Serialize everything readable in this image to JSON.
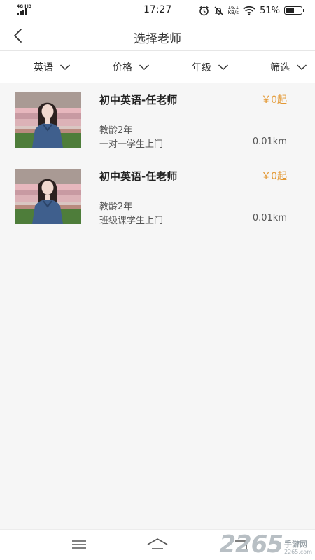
{
  "status_bar": {
    "network": "4G HD",
    "time": "17:27",
    "speed_value": "16.1",
    "speed_unit": "KB/s",
    "battery_level": "51%"
  },
  "header": {
    "title": "选择老师"
  },
  "filters": [
    {
      "label": "英语"
    },
    {
      "label": "价格"
    },
    {
      "label": "年级"
    },
    {
      "label": "筛选"
    }
  ],
  "teachers": [
    {
      "title": "初中英语-任老师",
      "price": "￥0起",
      "experience": "教龄2年",
      "mode": "一对一学生上门",
      "distance": "0.01km"
    },
    {
      "title": "初中英语-任老师",
      "price": "￥0起",
      "experience": "教龄2年",
      "mode": "班级课学生上门",
      "distance": "0.01km"
    }
  ],
  "watermark": {
    "number": "2265",
    "site": "手游网",
    "domain": "2265.com"
  },
  "colors": {
    "price": "#e39833",
    "background": "#f6f6f6"
  },
  "icons": [
    "back-arrow-icon",
    "chevron-down-icon",
    "menu-icon",
    "home-icon",
    "back-icon"
  ]
}
